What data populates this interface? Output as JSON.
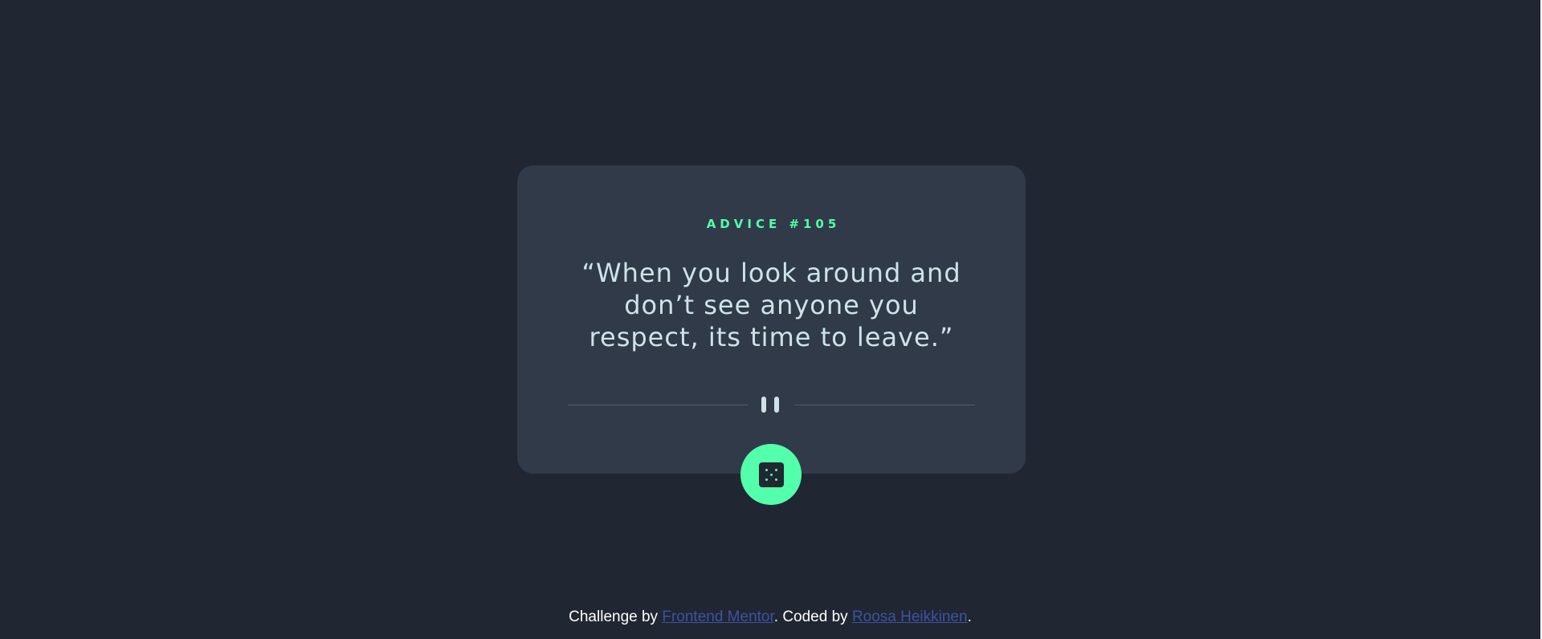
{
  "advice": {
    "number_label": "ADVICE #105",
    "quote": "“When you look around and don’t see anyone you respect, its time to leave.”"
  },
  "dice_button": {
    "icon": "dice-icon"
  },
  "divider": {
    "icon": "pause-icon"
  },
  "footer": {
    "prefix": "Challenge by ",
    "link1": "Frontend Mentor",
    "middle": ". Coded by ",
    "link2": "Roosa Heikkinen",
    "suffix": "."
  },
  "colors": {
    "background": "#202632",
    "card": "#313a49",
    "accent": "#53ffaa",
    "text": "#cee3e9",
    "divider": "#4f5d74",
    "link": "#3e52a3"
  }
}
